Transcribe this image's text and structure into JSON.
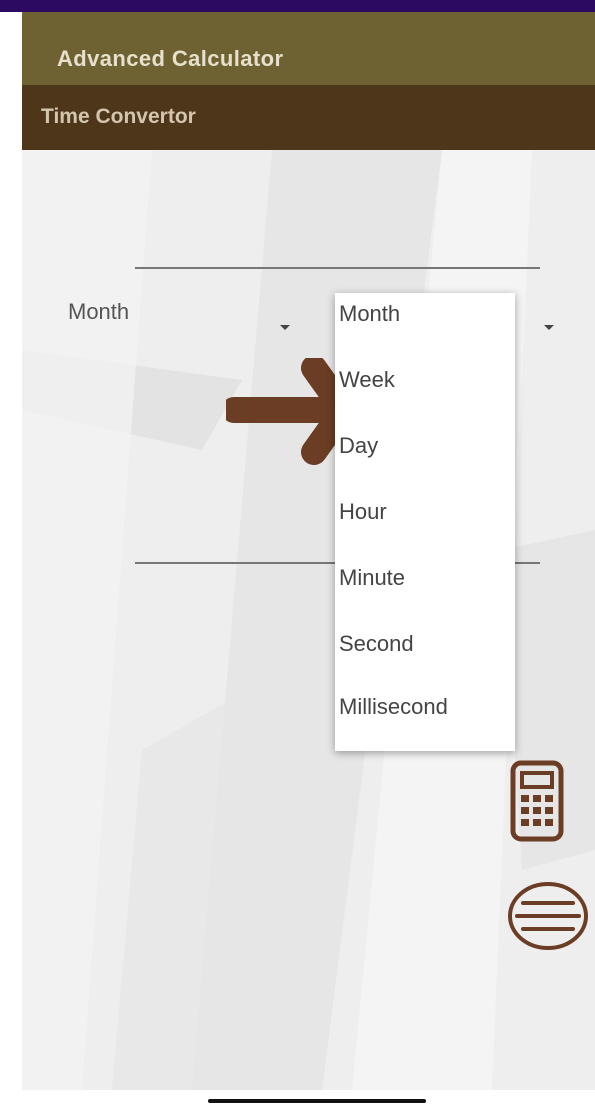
{
  "app_bar": {
    "title": "Advanced Calculator"
  },
  "sub_bar": {
    "title": "Time Convertor"
  },
  "converter": {
    "from_unit": "Month",
    "units": [
      "Month",
      "Week",
      "Day",
      "Hour",
      "Minute",
      "Second",
      "Millisecond"
    ]
  },
  "icons": {
    "swap": "arrow-right-icon",
    "calculator": "calculator-icon",
    "menu": "menu-icon"
  },
  "colors": {
    "status_bar": "#2c0a61",
    "app_bar": "#6e6132",
    "sub_bar": "#4e361b",
    "accent_brown": "#6a3d24"
  }
}
